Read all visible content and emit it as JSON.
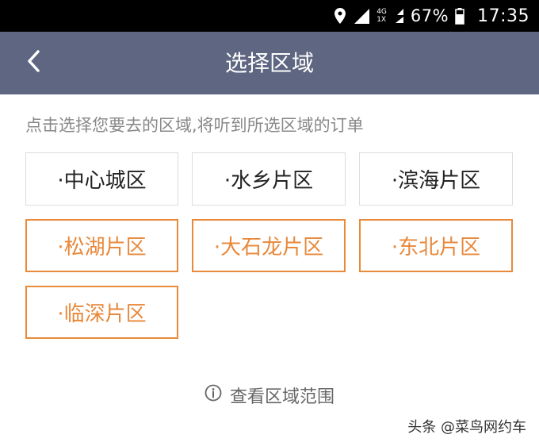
{
  "status_bar": {
    "network_top": "4G",
    "network_bottom": "1X",
    "battery_percent": "67%",
    "time": "17:35",
    "icons": [
      "location-icon",
      "signal-icon",
      "mobile-data-icon",
      "battery-icon"
    ]
  },
  "nav": {
    "back_icon": "chevron-left-icon",
    "title": "选择区域"
  },
  "instruction": "点击选择您要去的区域,将听到所选区域的订单",
  "regions": [
    {
      "label": "·中心城区",
      "selected": false
    },
    {
      "label": "·水乡片区",
      "selected": false
    },
    {
      "label": "·滨海片区",
      "selected": false
    },
    {
      "label": "·松湖片区",
      "selected": true
    },
    {
      "label": "·大石龙片区",
      "selected": true
    },
    {
      "label": "·东北片区",
      "selected": true
    },
    {
      "label": "·临深片区",
      "selected": true
    }
  ],
  "view_range": {
    "icon": "info-icon",
    "label": "查看区域范围"
  },
  "watermark": "头条 @菜鸟网约车",
  "colors": {
    "nav_background": "#5e6681",
    "selected_accent": "#e8883a",
    "border_default": "#dcdcdc"
  }
}
